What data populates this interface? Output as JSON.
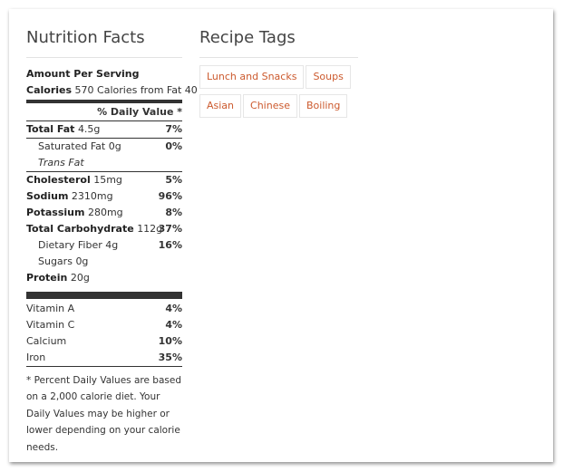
{
  "nutrition": {
    "title": "Nutrition Facts",
    "amount_per_serving": "Amount Per Serving",
    "calories_label": "Calories",
    "calories_value": "570",
    "calories_fat": "Calories from Fat 40",
    "daily_value_header": "% Daily Value *",
    "rows": [
      {
        "label": "Total Fat",
        "amount": "4.5g",
        "pct": "7%"
      },
      {
        "label": "Saturated Fat",
        "amount": "0g",
        "pct": "0%"
      },
      {
        "label": "Trans Fat",
        "amount": "",
        "pct": ""
      },
      {
        "label": "Cholesterol",
        "amount": "15mg",
        "pct": "5%"
      },
      {
        "label": "Sodium",
        "amount": "2310mg",
        "pct": "96%"
      },
      {
        "label": "Potassium",
        "amount": "280mg",
        "pct": "8%"
      },
      {
        "label": "Total Carbohydrate",
        "amount": "112g",
        "pct": "37%"
      },
      {
        "label": "Dietary Fiber",
        "amount": "4g",
        "pct": "16%"
      },
      {
        "label": "Sugars",
        "amount": "0g",
        "pct": ""
      },
      {
        "label": "Protein",
        "amount": "20g",
        "pct": ""
      }
    ],
    "vitamins": [
      {
        "label": "Vitamin A",
        "pct": "4%"
      },
      {
        "label": "Vitamin C",
        "pct": "4%"
      },
      {
        "label": "Calcium",
        "pct": "10%"
      },
      {
        "label": "Iron",
        "pct": "35%"
      }
    ],
    "footnote": "* Percent Daily Values are based on a 2,000 calorie diet. Your Daily Values may be higher or lower depending on your calorie needs."
  },
  "recipe_tags": {
    "title": "Recipe Tags",
    "tags": [
      "Lunch and Snacks",
      "Soups",
      "Asian",
      "Chinese",
      "Boiling"
    ]
  },
  "colors": {
    "tag_text": "#cc5a2e",
    "bar": "#333333"
  }
}
